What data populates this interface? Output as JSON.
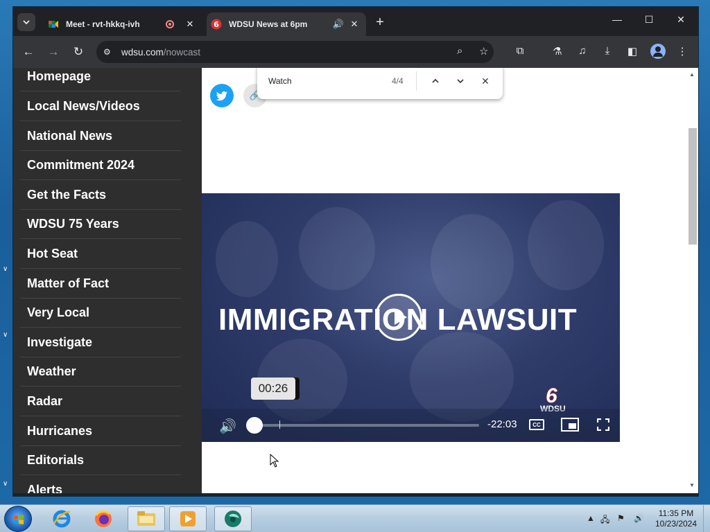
{
  "tabs": [
    {
      "title": "Meet - rvt-hkkq-ivh",
      "favicon": "google-meet-icon",
      "indicator": "recording-icon"
    },
    {
      "title": "WDSU News at 6pm",
      "favicon": "wdsu-icon",
      "indicator": "speaker-icon",
      "active": true
    }
  ],
  "address_bar": {
    "domain": "wdsu.com",
    "path": "/nowcast"
  },
  "find_bar": {
    "query": "Watch",
    "count": "4/4"
  },
  "sidebar": {
    "items": [
      "Homepage",
      "Local News/Videos",
      "National News",
      "Commitment 2024",
      "Get the Facts",
      "WDSU 75 Years",
      "Hot Seat",
      "Matter of Fact",
      "Very Local",
      "Investigate",
      "Weather",
      "Radar",
      "Hurricanes",
      "Editorials",
      "Alerts"
    ]
  },
  "video": {
    "headline": "IMMIGRATION LAWSUIT",
    "hover_time": "00:26",
    "remaining": "-22:03",
    "station": "WDSU",
    "station_number": "6",
    "progress_fraction": 0.06
  },
  "taskbar": {
    "time": "11:35 PM",
    "date": "10/23/2024"
  },
  "colors": {
    "sidebar_bg": "#2e2e2e",
    "twitter": "#1da1f2",
    "browser_frame": "#202124",
    "video_bg": "#2f3c6a"
  }
}
